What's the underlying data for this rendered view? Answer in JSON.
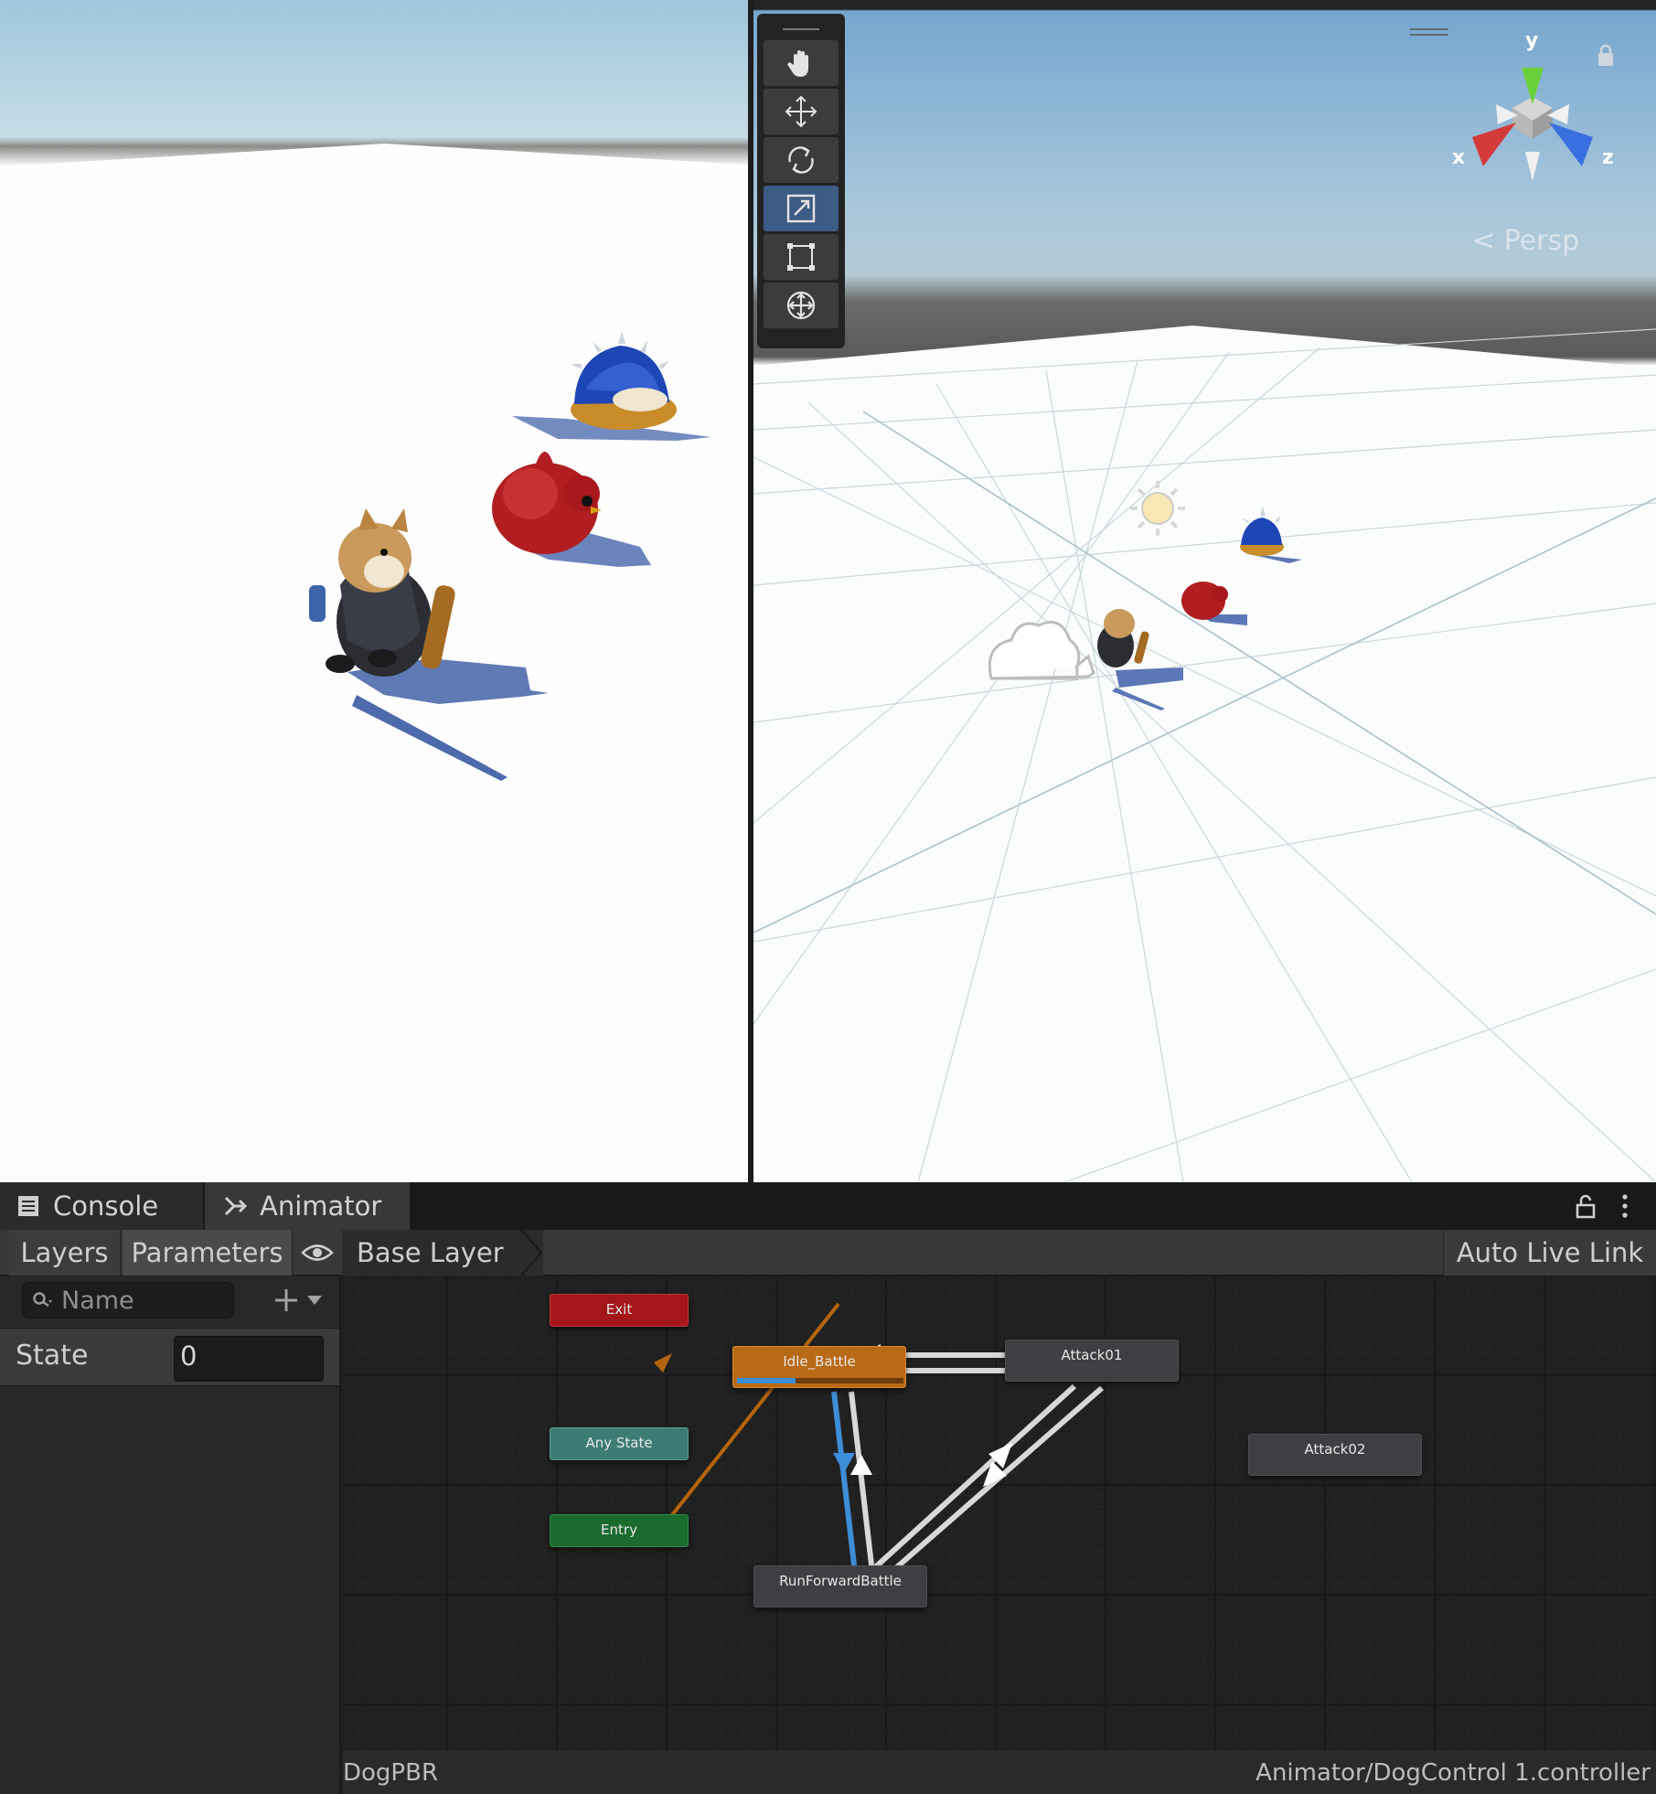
{
  "panel_tabs": {
    "console_label": "Console",
    "animator_label": "Animator"
  },
  "animator_toolbar": {
    "layers_label": "Layers",
    "parameters_label": "Parameters",
    "breadcrumb_layer": "Base Layer",
    "live_link_label": "Auto Live Link"
  },
  "parameters": {
    "search_placeholder": "Name",
    "items": [
      {
        "name": "State",
        "value": "0"
      }
    ]
  },
  "state_machine": {
    "nodes": {
      "exit": "Exit",
      "idle_battle": "Idle_Battle",
      "attack01": "Attack01",
      "any_state": "Any State",
      "entry": "Entry",
      "attack02": "Attack02",
      "run_forward_battle": "RunForwardBattle"
    },
    "idle_progress_percent": 35
  },
  "status_bar": {
    "object_name": "DogPBR",
    "controller_path": "Animator/DogControl 1.controller"
  },
  "scene_view": {
    "projection_label": "Persp",
    "axis_x": "x",
    "axis_y": "y",
    "axis_z": "z",
    "tools": [
      "hand-tool",
      "move-tool",
      "rotate-tool",
      "scale-tool",
      "rect-tool",
      "transform-tool"
    ],
    "active_tool": "scale-tool"
  },
  "colors": {
    "default_state": "#b96a17",
    "exit_state": "#a31619",
    "any_state": "#3c7c74",
    "entry_state": "#1b6b2f",
    "active_transition": "#3d8ed8",
    "entry_transition": "#b5650d"
  }
}
